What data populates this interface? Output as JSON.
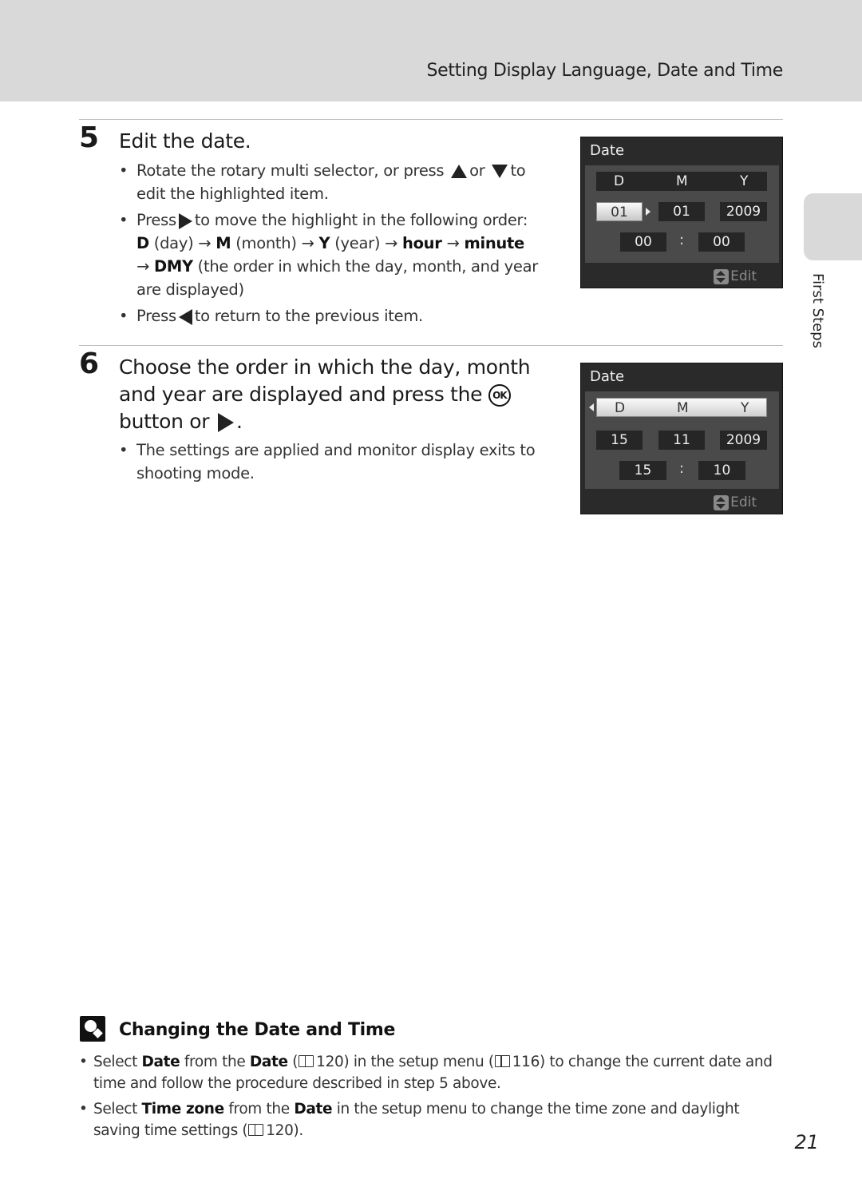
{
  "header": {
    "title": "Setting Display Language, Date and Time"
  },
  "side_tab": {
    "label": "First Steps"
  },
  "step5": {
    "number": "5",
    "title": "Edit the date.",
    "bullet1": {
      "pre": "Rotate the rotary multi selector, or press",
      "or": "or",
      "post": "to edit the highlighted item."
    },
    "bullet2": {
      "pre": "Press",
      "post": "to move the highlight in the following order:",
      "seq": [
        {
          "bold": "D",
          "text": " (day) "
        },
        {
          "bold": "M",
          "text": " (month) "
        },
        {
          "bold": "Y",
          "text": " (year) "
        },
        {
          "bold": "hour",
          "text": " "
        },
        {
          "bold": "minute",
          "text": ""
        },
        {
          "bold": "DMY",
          "text": " (the order in which the day, month, and year are displayed)"
        }
      ],
      "arrow": "→"
    },
    "bullet3": {
      "pre": "Press",
      "post": "to return to the previous item."
    },
    "screen": {
      "title": "Date",
      "headers": [
        "D",
        "M",
        "Y"
      ],
      "day": "01",
      "month": "01",
      "year": "2009",
      "hour": "00",
      "minute": "00",
      "colon": ":",
      "edit_label": "Edit",
      "highlighted": "day"
    }
  },
  "step6": {
    "number": "6",
    "title_line1": "Choose the order in which the day, month",
    "title_line2": "and year are displayed and press the",
    "title_line3": "button or",
    "ok_label": "OK",
    "bullet1": "The settings are applied and monitor display exits to shooting mode.",
    "screen": {
      "title": "Date",
      "headers": [
        "D",
        "M",
        "Y"
      ],
      "day": "15",
      "month": "11",
      "year": "2009",
      "hour": "15",
      "minute": "10",
      "colon": ":",
      "edit_label": "Edit",
      "highlighted": "DMY"
    }
  },
  "tip": {
    "title": "Changing the Date and Time",
    "bullet1": {
      "t1": "Select ",
      "b1": "Date",
      "t2": " from the ",
      "b2": "Date",
      "t3": " (",
      "ref1": "120",
      "t4": ") in the setup menu (",
      "ref2": "116",
      "t5": ") to change the current date and time and follow the procedure described in step 5 above."
    },
    "bullet2": {
      "t1": "Select ",
      "b1": "Time zone",
      "t2": " from the ",
      "b2": "Date",
      "t3": " in the setup menu to change the time zone and daylight saving time settings (",
      "ref1": "120",
      "t4": ")."
    }
  },
  "page_number": "21"
}
